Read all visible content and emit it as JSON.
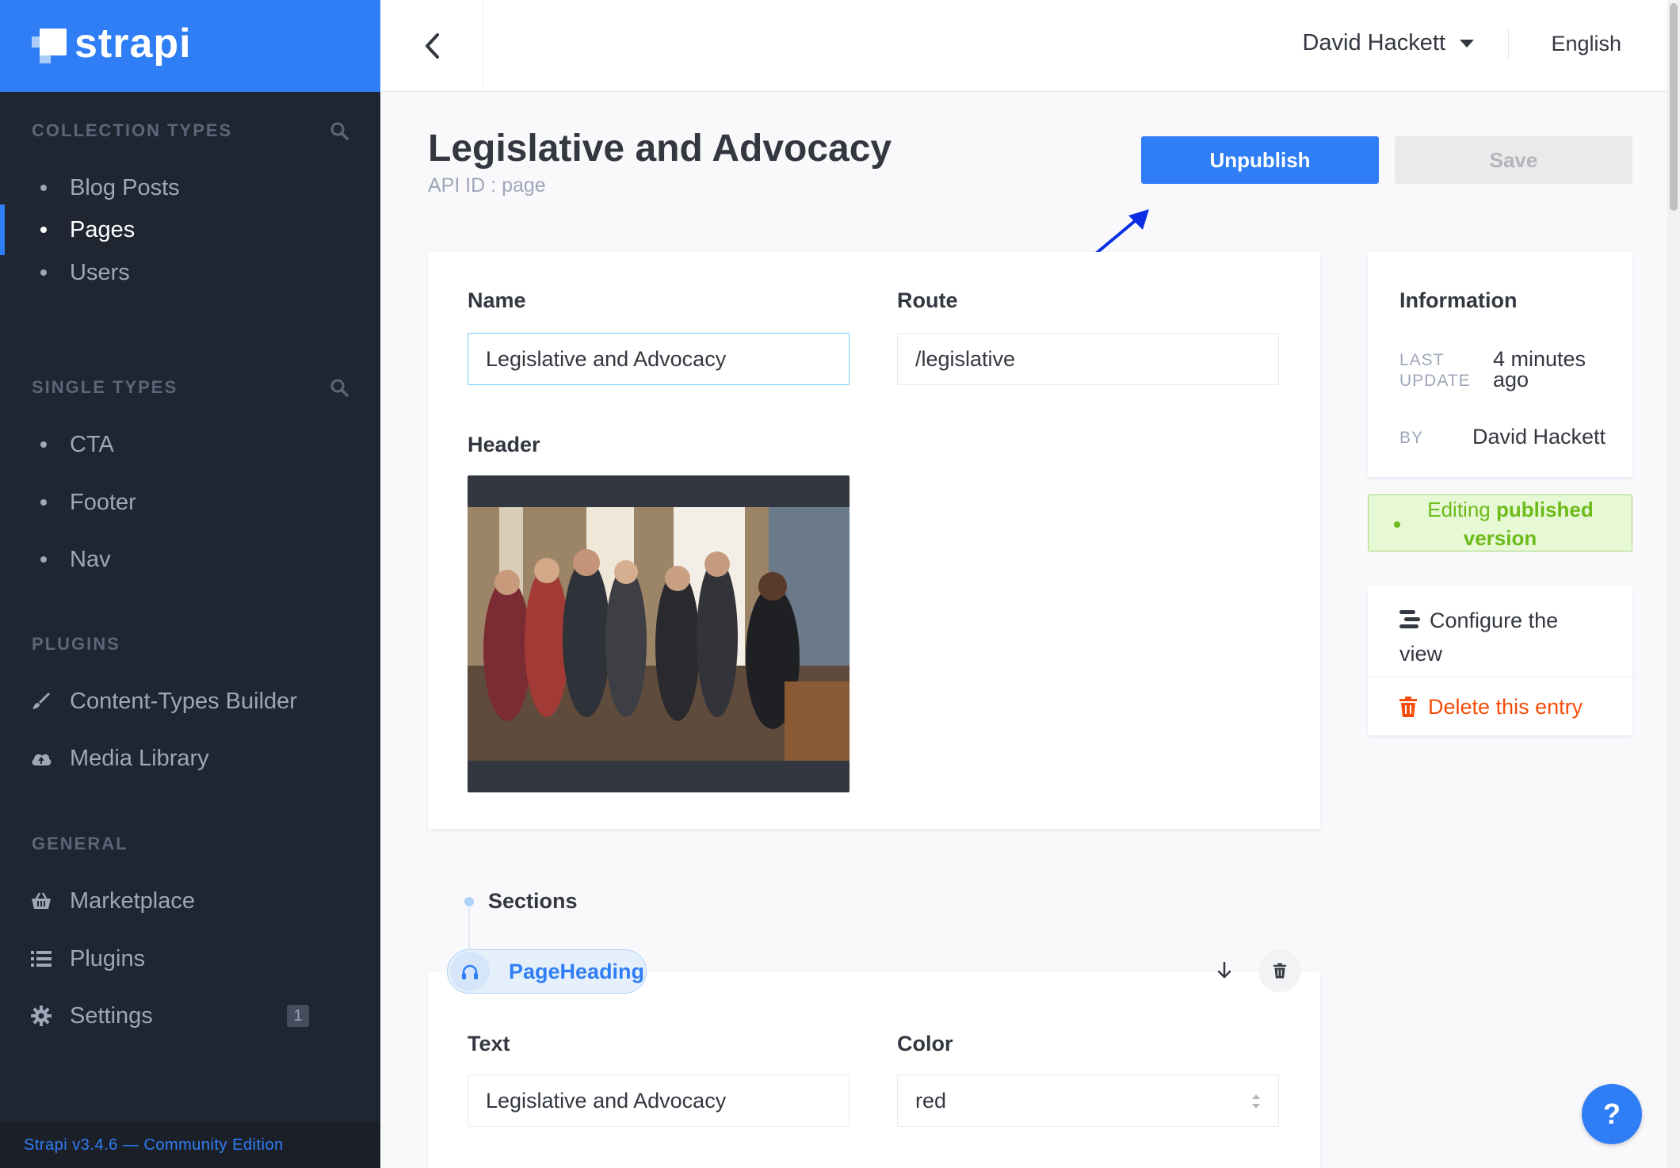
{
  "sidebar": {
    "brand": "strapi",
    "collection_types": {
      "title": "COLLECTION TYPES",
      "items": [
        {
          "label": "Blog Posts"
        },
        {
          "label": "Pages"
        },
        {
          "label": "Users"
        }
      ]
    },
    "single_types": {
      "title": "SINGLE TYPES",
      "items": [
        {
          "label": "CTA"
        },
        {
          "label": "Footer"
        },
        {
          "label": "Nav"
        }
      ]
    },
    "plugins": {
      "title": "PLUGINS",
      "items": [
        {
          "label": "Content-Types Builder",
          "icon": "paintbrush-icon"
        },
        {
          "label": "Media Library",
          "icon": "cloud-upload-icon"
        }
      ]
    },
    "general": {
      "title": "GENERAL",
      "items": [
        {
          "label": "Marketplace",
          "icon": "basket-icon"
        },
        {
          "label": "Plugins",
          "icon": "list-icon"
        },
        {
          "label": "Settings",
          "icon": "gear-icon",
          "badge": "1"
        }
      ]
    },
    "footer": "Strapi v3.4.6 — Community Edition"
  },
  "header": {
    "user": "David Hackett",
    "language": "English"
  },
  "page": {
    "title": "Legislative and Advocacy",
    "api_id": "API ID : page",
    "unpublish_label": "Unpublish",
    "save_label": "Save"
  },
  "form": {
    "name_label": "Name",
    "name_value": "Legislative and Advocacy",
    "route_label": "Route",
    "route_value": "/legislative",
    "header_label": "Header"
  },
  "info": {
    "title": "Information",
    "last_update_key_1": "LAST",
    "last_update_key_2": "UPDATE",
    "last_update_val_1": "4 minutes",
    "last_update_val_2": "ago",
    "by_key": "BY",
    "by_val": "David Hackett",
    "status_prefix": "Editing",
    "status_bold_1": "published",
    "status_bold_2": "version",
    "configure_1": "Configure the",
    "configure_2": "view",
    "delete": "Delete this entry"
  },
  "sections": {
    "label": "Sections",
    "component": "PageHeading",
    "text_label": "Text",
    "text_value": "Legislative and Advocacy",
    "color_label": "Color",
    "color_value": "red"
  },
  "help": "?",
  "colors": {
    "brand_blue": "#2f7ef5",
    "sidebar_bg": "#1f2531",
    "danger": "#f64d0a",
    "success": "#6dbb1a"
  }
}
